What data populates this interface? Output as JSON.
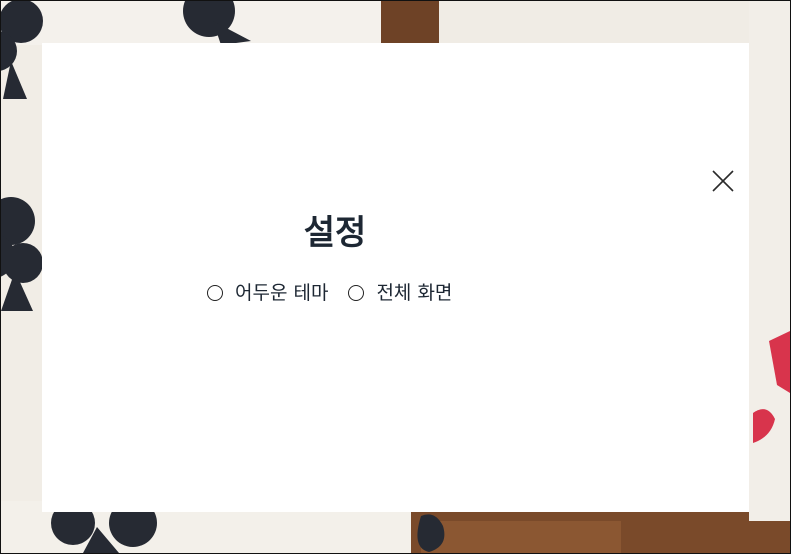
{
  "dialog": {
    "title": "설정",
    "close_icon": "close-icon",
    "options": [
      {
        "label": "어두운 테마",
        "checked": false
      },
      {
        "label": "전체 화면",
        "checked": false
      }
    ]
  },
  "background": {
    "description_icon": "playing-cards-background",
    "colors": {
      "club": "#262a33",
      "wood": "#7a4a2a",
      "red_suit": "#d8344c",
      "card": "#f3f0ea"
    }
  }
}
